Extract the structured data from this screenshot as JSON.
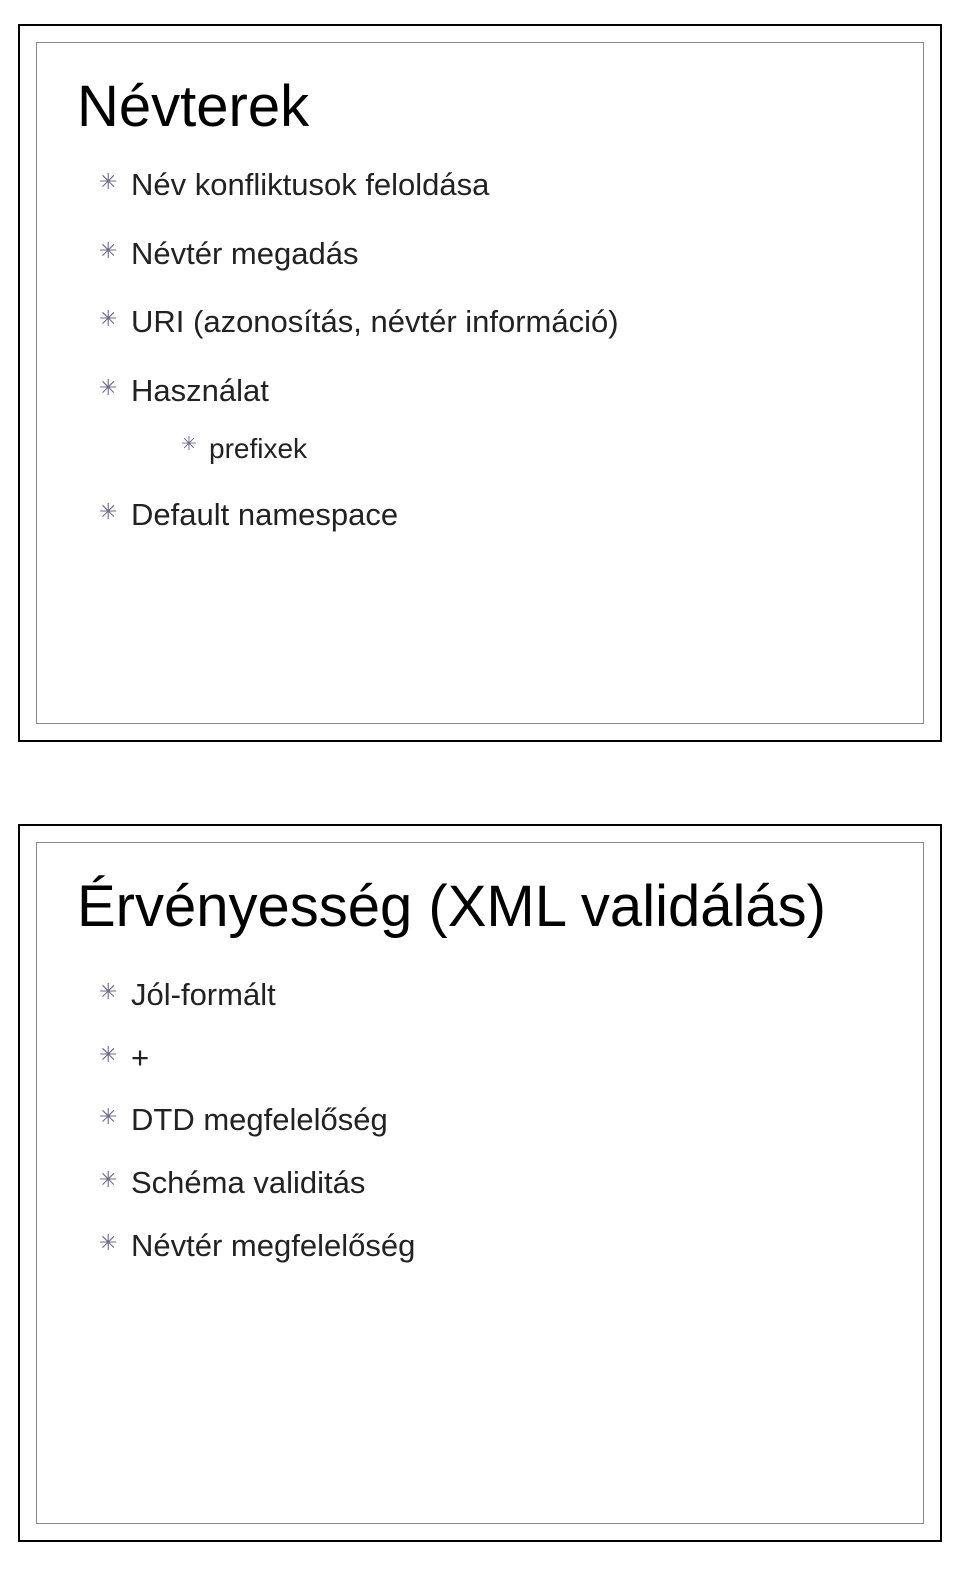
{
  "slides": [
    {
      "title": "Névterek",
      "items": [
        {
          "text": "Név konfliktusok feloldása"
        },
        {
          "text": "Névtér megadás"
        },
        {
          "text": "URI (azonosítás, névtér információ)"
        },
        {
          "text": "Használat",
          "children": [
            {
              "text": "prefixek"
            }
          ]
        },
        {
          "text": "Default namespace"
        }
      ]
    },
    {
      "title": "Érvényesség (XML validálás)",
      "items": [
        {
          "text": "Jól-formált"
        },
        {
          "text": "+"
        },
        {
          "text": "DTD megfelelőség"
        },
        {
          "text": "Schéma validitás"
        },
        {
          "text": "Névtér megfelelőség"
        }
      ]
    }
  ]
}
